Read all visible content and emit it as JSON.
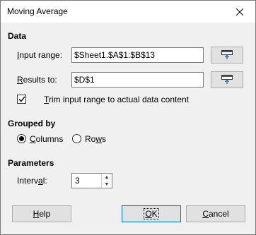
{
  "window": {
    "title": "Moving Average"
  },
  "data_section": {
    "heading": "Data",
    "input_range_label_ul": "I",
    "input_range_label_rest": "nput range:",
    "input_range_value": "$Sheet1.$A$1:$B$13",
    "results_to_label_ul": "R",
    "results_to_label_rest": "esults to:",
    "results_to_value": "$D$1",
    "trim_label_ul": "T",
    "trim_label_rest": "rim input range to actual data content",
    "trim_checked": true
  },
  "grouped_by": {
    "heading": "Grouped by",
    "columns_ul": "C",
    "columns_rest": "olumns",
    "rows_pre": "Ro",
    "rows_ul": "w",
    "rows_rest": "s",
    "selected": "Columns"
  },
  "parameters": {
    "heading": "Parameters",
    "interval_pre": "Interv",
    "interval_ul": "a",
    "interval_rest": "l:",
    "interval_value": "3"
  },
  "buttons": {
    "help_ul": "H",
    "help_rest": "elp",
    "ok_ul": "O",
    "ok_rest": "K",
    "cancel_ul": "C",
    "cancel_rest": "ancel"
  },
  "icons": {
    "close": "close-icon",
    "shrink": "shrink-icon",
    "check": "checkmark-icon",
    "spin_up": "spin-up-icon",
    "spin_down": "spin-down-icon"
  }
}
